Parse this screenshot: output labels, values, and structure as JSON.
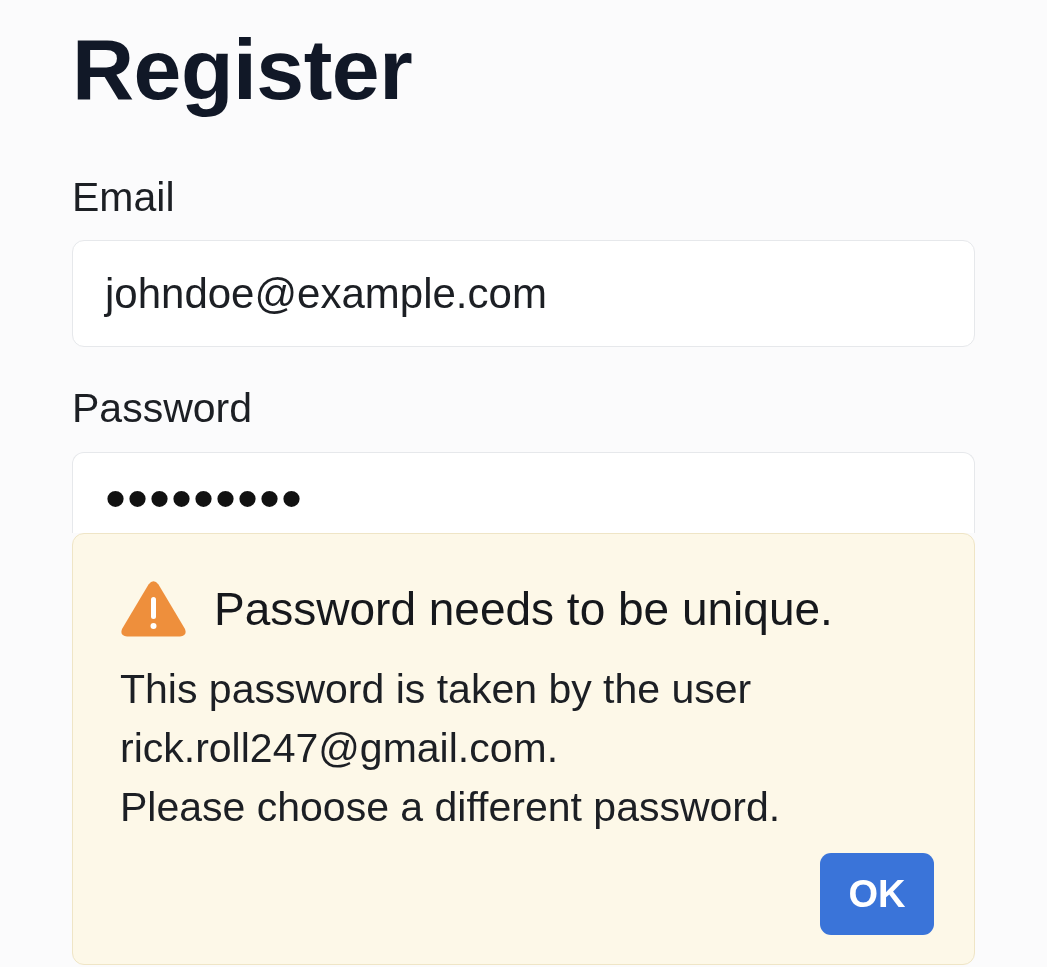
{
  "page": {
    "title": "Register"
  },
  "form": {
    "fields": [
      {
        "label": "Email",
        "value": "johndoe@example.com",
        "kind": "text"
      },
      {
        "label": "Password",
        "value": "•••••••••",
        "kind": "password"
      }
    ]
  },
  "alert": {
    "title": "Password needs to be unique.",
    "message": [
      "This password is taken by the user rick.roll247@gmail.com.",
      "Please choose a different password."
    ],
    "button": "OK"
  }
}
